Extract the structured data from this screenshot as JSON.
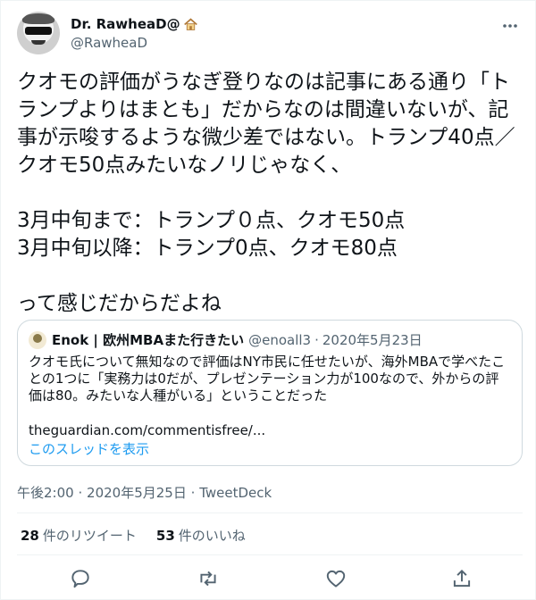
{
  "author": {
    "display_name": "Dr. RawheaD@",
    "handle": "@RawheaD",
    "name_emoji_icon": "house-icon",
    "avatar_icon": "skull-sunglasses-avatar"
  },
  "tweet": {
    "text": "クオモの評価がうなぎ登りなのは記事にある通り「ト\nランプよりはまとも」だからなのは間違いないが、記\n事が示唆するような微少差ではない。トランプ40点／\nクオモ50点みたいなノリじゃなく、\n\n3月中旬まで：トランプ０点、クオモ50点\n3月中旬以降：トランプ0点、クオモ80点\n\nって感じだからだよね"
  },
  "quoted": {
    "author_name": "Enok | 欧州MBAまた行きたい",
    "author_handle": "@enoall3",
    "separator": "·",
    "date": "2020年5月23日",
    "text": "クオモ氏について無知なので評価はNY市民に任せたいが、海外MBAで学べたことの1つに「実務力は0だが、プレゼンテーション力が100なので、外からの評価は80。みたいな人種がいる」ということだった",
    "link": "theguardian.com/commentisfree/...",
    "thread_label": "このスレッドを表示"
  },
  "meta": {
    "time": "午後2:00",
    "separator": "·",
    "date": "2020年5月25日",
    "source": "TweetDeck"
  },
  "stats": {
    "retweets_count": "28",
    "retweets_label": "件のリツイート",
    "likes_count": "53",
    "likes_label": "件のいいね"
  },
  "actions": [
    "reply-icon",
    "retweet-icon",
    "like-icon",
    "share-icon"
  ],
  "colors": {
    "text": "#0f1419",
    "secondary": "#536471",
    "link": "#1d9bf0",
    "border": "#cfd9de"
  }
}
